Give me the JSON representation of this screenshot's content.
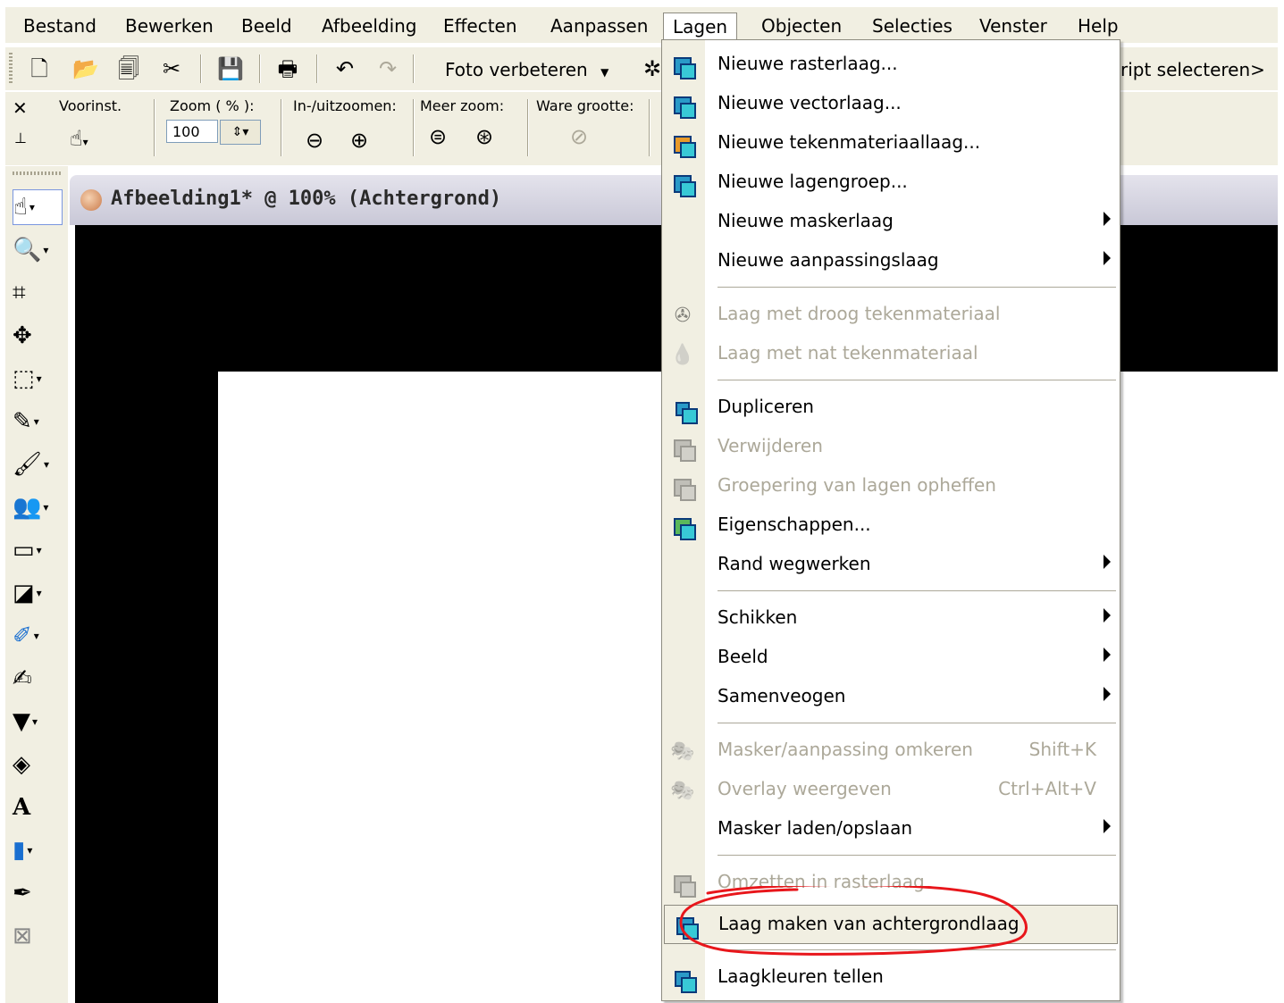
{
  "menubar": {
    "items": [
      "Bestand",
      "Bewerken",
      "Beeld",
      "Afbeelding",
      "Effecten",
      "Aanpassen",
      "Lagen",
      "Objecten",
      "Selecties",
      "Venster",
      "Help"
    ],
    "active": "Lagen"
  },
  "toolbar": {
    "foto_verbeteren": "Foto verbeteren",
    "script_select": "ript selecteren>",
    "icons": [
      "new-icon",
      "open-icon",
      "browse-icon",
      "scan-icon",
      "save-icon",
      "print-icon",
      "undo-icon",
      "redo-icon"
    ]
  },
  "options": {
    "voorinst_label": "Voorinst.",
    "zoom_label": "Zoom ( % ):",
    "zoom_value": "100",
    "inuit_label": "In-/uitzoomen:",
    "meer_label": "Meer zoom:",
    "ware_label": "Ware grootte:"
  },
  "document": {
    "title": "Afbeelding1* @ 100% (Achtergrond)"
  },
  "tools": [
    "pan-icon",
    "zoom-icon",
    "crop-icon",
    "move-icon",
    "selection-icon",
    "dropper-icon",
    "paintbrush-icon",
    "clone-icon",
    "picture-tube-icon",
    "fill-icon",
    "eraser-icon",
    "retouch-icon",
    "airbrush-icon",
    "flood-fill-icon",
    "text-icon",
    "shape-icon",
    "pen-icon",
    "warp-icon"
  ],
  "menu": {
    "items": [
      {
        "label": "Nieuwe rasterlaag...",
        "icon": "raster-layer-icon"
      },
      {
        "label": "Nieuwe vectorlaag...",
        "icon": "vector-layer-icon"
      },
      {
        "label": "Nieuwe tekenmateriaallaag...",
        "icon": "art-media-layer-icon"
      },
      {
        "label": "Nieuwe lagengroep...",
        "icon": "layer-group-icon"
      },
      {
        "label": "Nieuwe maskerlaag",
        "submenu": true
      },
      {
        "label": "Nieuwe aanpassingslaag",
        "submenu": true
      },
      {
        "label": "Laag met droog tekenmateriaal",
        "disabled": true,
        "icon": "dry-media-icon"
      },
      {
        "label": "Laag met nat tekenmateriaal",
        "disabled": true,
        "icon": "wet-media-icon"
      },
      {
        "label": "Dupliceren",
        "icon": "duplicate-icon"
      },
      {
        "label": "Verwijderen",
        "disabled": true,
        "icon": "delete-layer-icon"
      },
      {
        "label": "Groepering van lagen opheffen",
        "disabled": true,
        "icon": "ungroup-icon"
      },
      {
        "label": "Eigenschappen...",
        "icon": "properties-icon"
      },
      {
        "label": "Rand wegwerken",
        "submenu": true
      },
      {
        "label": "Schikken",
        "submenu": true
      },
      {
        "label": "Beeld",
        "submenu": true
      },
      {
        "label": "Samenveogen",
        "submenu": true
      },
      {
        "label": "Masker/aanpassing omkeren",
        "shortcut": "Shift+K",
        "disabled": true,
        "icon": "invert-mask-icon"
      },
      {
        "label": "Overlay weergeven",
        "shortcut": "Ctrl+Alt+V",
        "disabled": true,
        "icon": "overlay-icon"
      },
      {
        "label": "Masker laden/opslaan",
        "submenu": true
      },
      {
        "label": "Omzetten in rasterlaag",
        "disabled": true,
        "icon": "convert-raster-icon"
      },
      {
        "label": "Laag maken van achtergrondlaag",
        "icon": "promote-background-icon",
        "highlighted": true
      },
      {
        "label": "Laagkleuren tellen",
        "icon": "count-colors-icon"
      }
    ]
  },
  "colors": {
    "chrome": "#f1efe2",
    "disabled_text": "#aca899",
    "annotation": "#e8161b"
  }
}
